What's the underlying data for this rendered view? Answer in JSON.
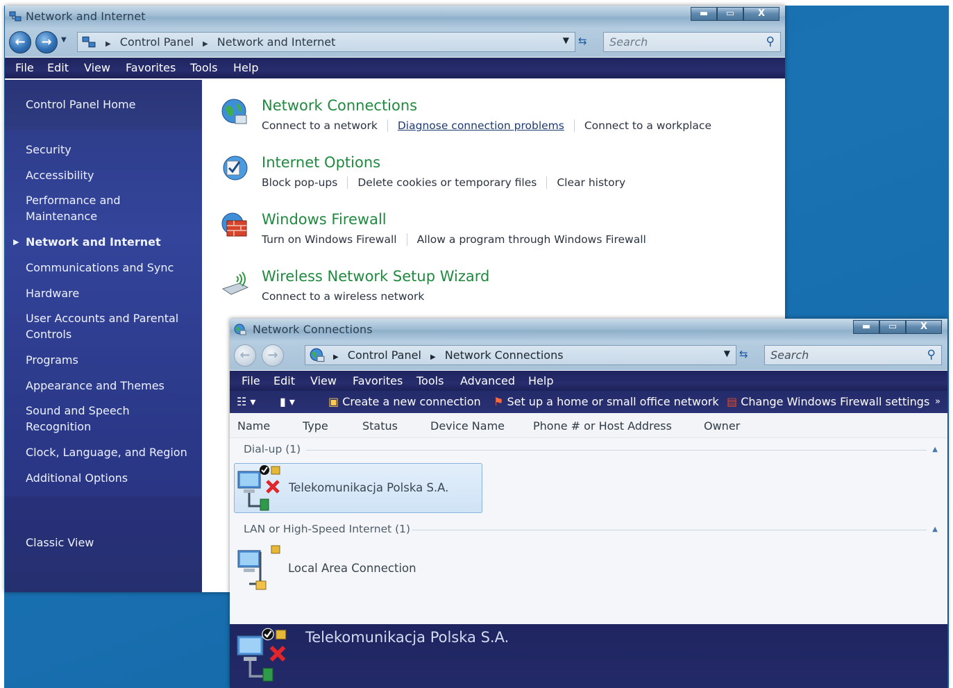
{
  "colors": {
    "desktop": "#1a72b3",
    "sidebar": "#33449a",
    "menubar": "#272d6d",
    "task_title": "#1f8a3f",
    "selection": "#cfe3f6"
  },
  "control_panel": {
    "title": "Network and Internet",
    "window_buttons": {
      "minimize": "▬",
      "maximize": "▭",
      "close": "X"
    },
    "breadcrumb": [
      "Control Panel",
      "Network and Internet"
    ],
    "search_placeholder": "Search",
    "menu": [
      "File",
      "Edit",
      "View",
      "Favorites",
      "Tools",
      "Help"
    ],
    "sidebar": {
      "home": "Control Panel Home",
      "items": [
        "Security",
        "Accessibility",
        "Performance and\nMaintenance",
        "Network and Internet",
        "Communications and Sync",
        "Hardware",
        "User Accounts and Parental\nControls",
        "Programs",
        "Appearance and Themes",
        "Sound and Speech\nRecognition",
        "Clock, Language, and Region",
        "Additional Options"
      ],
      "classic_view": "Classic View"
    },
    "tasks": [
      {
        "title": "Network Connections",
        "icon": "globe-network-icon",
        "links": [
          "Connect to a network",
          "Diagnose connection problems",
          "Connect to a workplace"
        ]
      },
      {
        "title": "Internet Options",
        "icon": "internet-options-icon",
        "links": [
          "Block pop-ups",
          "Delete cookies or temporary files",
          "Clear history"
        ]
      },
      {
        "title": "Windows Firewall",
        "icon": "firewall-icon",
        "links": [
          "Turn on Windows Firewall",
          "Allow a program through Windows Firewall"
        ]
      },
      {
        "title": "Wireless Network Setup Wizard",
        "icon": "wireless-icon",
        "links": [
          "Connect to a wireless network"
        ]
      }
    ]
  },
  "network_connections": {
    "title": "Network Connections",
    "window_buttons": {
      "minimize": "▬",
      "maximize": "▭",
      "close": "X"
    },
    "breadcrumb": [
      "Control Panel",
      "Network Connections"
    ],
    "search_placeholder": "Search",
    "menu": [
      "File",
      "Edit",
      "View",
      "Favorites",
      "Tools",
      "Advanced",
      "Help"
    ],
    "toolbar": {
      "create": "Create a new connection",
      "setup": "Set up a home or small office network",
      "firewall": "Change Windows Firewall settings",
      "more": "»"
    },
    "columns": [
      "Name",
      "Type",
      "Status",
      "Device Name",
      "Phone # or Host Address",
      "Owner"
    ],
    "groups": [
      {
        "label": "Dial-up (1)",
        "items": [
          "Telekomunikacja Polska S.A."
        ]
      },
      {
        "label": "LAN or High-Speed Internet (1)",
        "items": [
          "Local Area Connection"
        ]
      }
    ],
    "details_title": "Telekomunikacja Polska S.A."
  }
}
